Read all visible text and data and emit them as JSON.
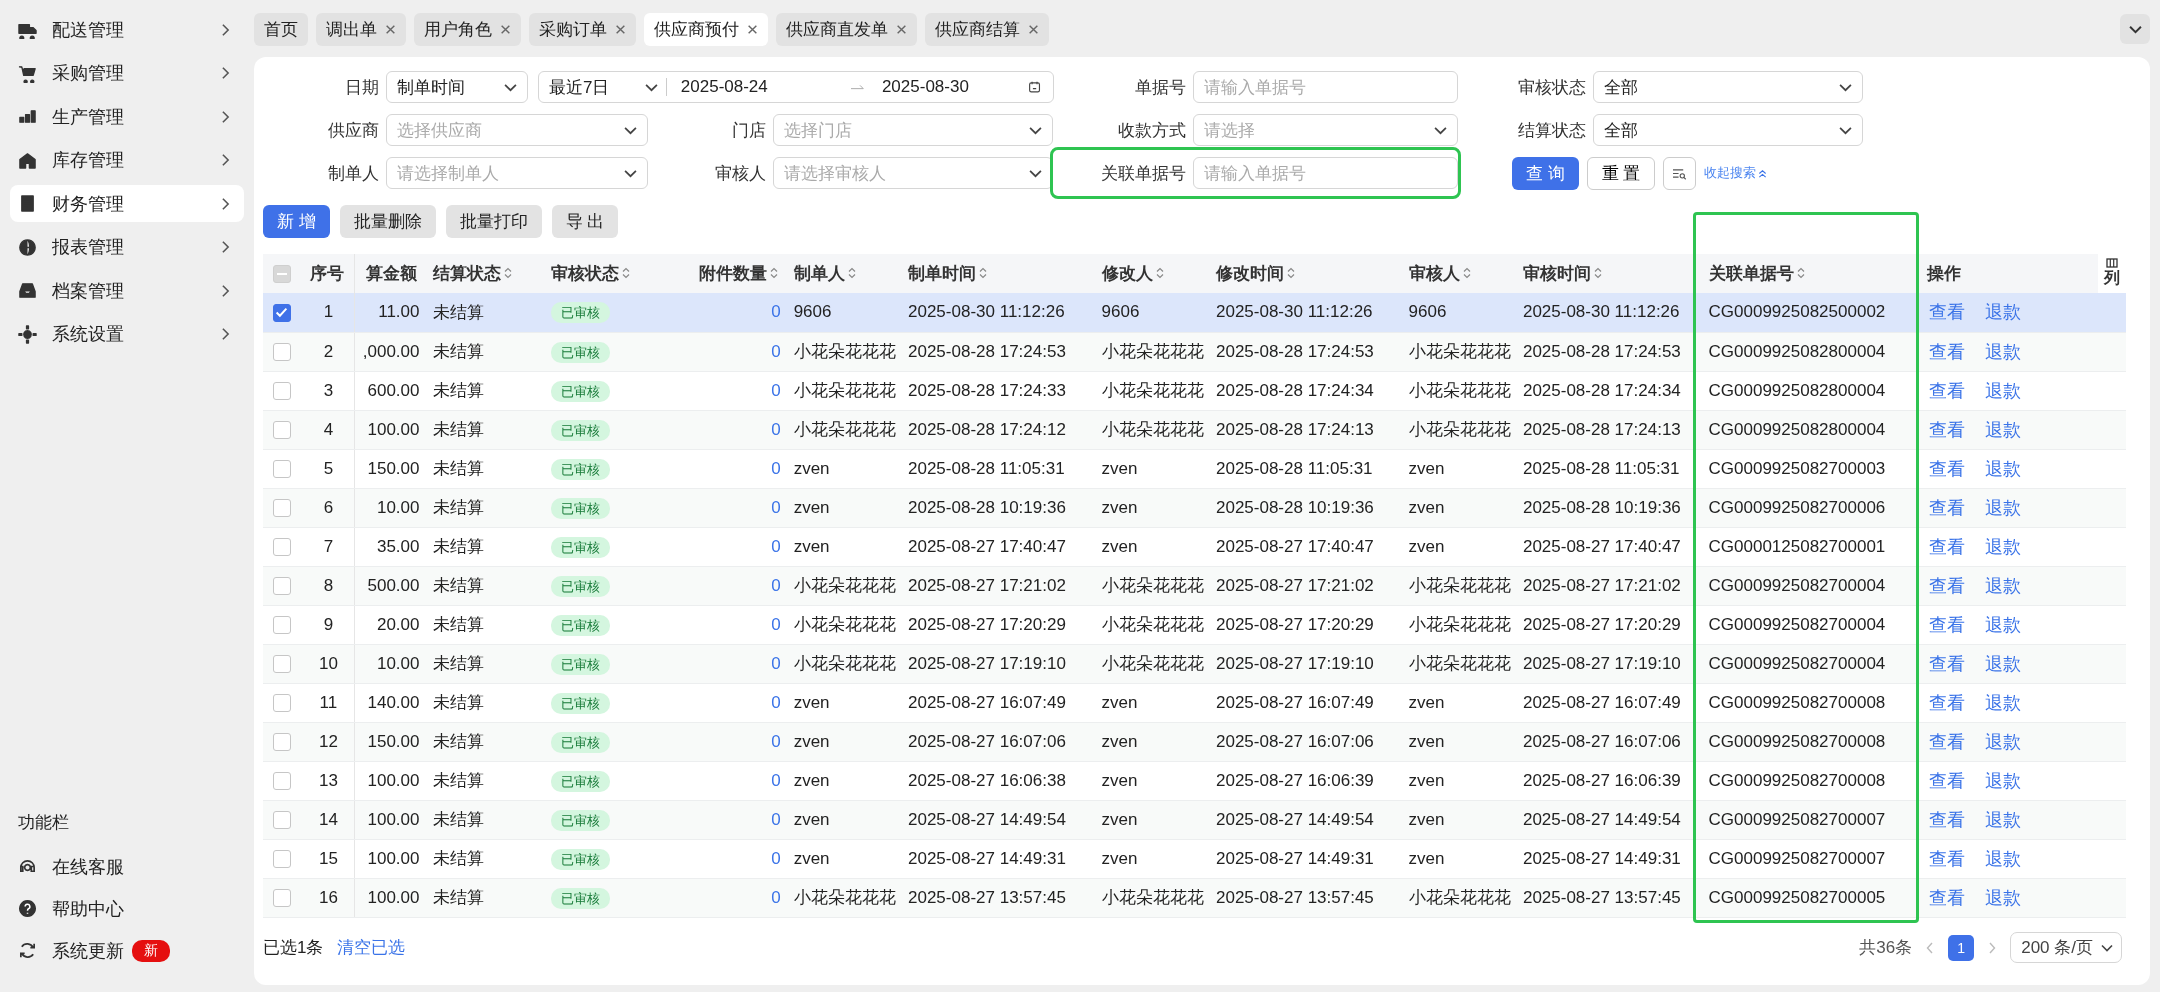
{
  "sidebar": {
    "items": [
      {
        "label": "配送管理",
        "selected": false
      },
      {
        "label": "采购管理",
        "selected": false
      },
      {
        "label": "生产管理",
        "selected": false
      },
      {
        "label": "库存管理",
        "selected": false
      },
      {
        "label": "财务管理",
        "selected": true
      },
      {
        "label": "报表管理",
        "selected": false
      },
      {
        "label": "档案管理",
        "selected": false
      },
      {
        "label": "系统设置",
        "selected": false
      }
    ],
    "footer_title": "功能栏",
    "footer_items": [
      {
        "label": "在线客服"
      },
      {
        "label": "帮助中心"
      },
      {
        "label": "系统更新",
        "badge": "新"
      }
    ]
  },
  "tabs": [
    {
      "label": "首页",
      "closable": false,
      "selected": false
    },
    {
      "label": "调出单",
      "closable": true,
      "selected": false
    },
    {
      "label": "用户角色",
      "closable": true,
      "selected": false
    },
    {
      "label": "采购订单",
      "closable": true,
      "selected": false
    },
    {
      "label": "供应商预付",
      "closable": true,
      "selected": true
    },
    {
      "label": "供应商直发单",
      "closable": true,
      "selected": false
    },
    {
      "label": "供应商结算",
      "closable": true,
      "selected": false
    }
  ],
  "filters": {
    "rows": [
      [
        {
          "kind": "date",
          "label": "日期",
          "value": "制单时间",
          "preset": "最近7日",
          "start": "2025-08-24",
          "end": "2025-08-30"
        },
        "",
        {
          "kind": "input",
          "label": "单据号",
          "placeholder": "请输入单据号"
        },
        {
          "kind": "select",
          "label": "审核状态",
          "value": "全部"
        }
      ],
      [
        {
          "kind": "select",
          "label": "供应商",
          "placeholder": "选择供应商"
        },
        {
          "kind": "select",
          "label": "门店",
          "placeholder": "选择门店"
        },
        {
          "kind": "select",
          "label": "收款方式",
          "placeholder": "请选择"
        },
        {
          "kind": "select",
          "label": "结算状态",
          "value": "全部"
        }
      ],
      [
        {
          "kind": "select",
          "label": "制单人",
          "placeholder": "请选择制单人"
        },
        {
          "kind": "select",
          "label": "审核人",
          "placeholder": "请选择审核人"
        },
        {
          "kind": "input",
          "label": "关联单据号",
          "placeholder": "请输入单据号",
          "highlighted": true
        }
      ]
    ],
    "query": "查 询",
    "reset": "重 置",
    "collapse": "收起搜索"
  },
  "actions": [
    {
      "label": "新 增",
      "primary": true
    },
    {
      "label": "批量删除",
      "primary": false
    },
    {
      "label": "批量打印",
      "primary": false
    },
    {
      "label": "导 出",
      "primary": false
    }
  ],
  "table": {
    "columns": [
      {
        "label": "序号",
        "sortable": false
      },
      {
        "label": "算金额",
        "sortable": false
      },
      {
        "label": "结算状态",
        "sortable": true
      },
      {
        "label": "审核状态",
        "sortable": true
      },
      {
        "label": "附件数量",
        "sortable": true
      },
      {
        "label": "制单人",
        "sortable": true
      },
      {
        "label": "制单时间",
        "sortable": true
      },
      {
        "label": "修改人",
        "sortable": true
      },
      {
        "label": "修改时间",
        "sortable": true
      },
      {
        "label": "审核人",
        "sortable": true
      },
      {
        "label": "审核时间",
        "sortable": true
      },
      {
        "label": "关联单据号",
        "sortable": true,
        "highlighted": true
      },
      {
        "label": "操作",
        "sortable": false
      },
      {
        "label": "列"
      }
    ],
    "select_all_checked": false,
    "select_all_partial": true,
    "rows": [
      {
        "selected": true,
        "cells": [
          "1",
          "11.00",
          "未结算",
          "已审核",
          "0",
          "9606",
          "2025-08-30 11:12:26",
          "9606",
          "2025-08-30 11:12:26",
          "9606",
          "2025-08-30 11:12:26",
          "CG0009925082500002"
        ],
        "ops": [
          "查看",
          "退款"
        ]
      },
      {
        "selected": false,
        "cells": [
          "2",
          ",000.00",
          "未结算",
          "已审核",
          "0",
          "小花朵花花花",
          "2025-08-28 17:24:53",
          "小花朵花花花",
          "2025-08-28 17:24:53",
          "小花朵花花花",
          "2025-08-28 17:24:53",
          "CG0009925082800004"
        ],
        "ops": [
          "查看",
          "退款"
        ]
      },
      {
        "selected": false,
        "cells": [
          "3",
          "600.00",
          "未结算",
          "已审核",
          "0",
          "小花朵花花花",
          "2025-08-28 17:24:33",
          "小花朵花花花",
          "2025-08-28 17:24:34",
          "小花朵花花花",
          "2025-08-28 17:24:34",
          "CG0009925082800004"
        ],
        "ops": [
          "查看",
          "退款"
        ]
      },
      {
        "selected": false,
        "cells": [
          "4",
          "100.00",
          "未结算",
          "已审核",
          "0",
          "小花朵花花花",
          "2025-08-28 17:24:12",
          "小花朵花花花",
          "2025-08-28 17:24:13",
          "小花朵花花花",
          "2025-08-28 17:24:13",
          "CG0009925082800004"
        ],
        "ops": [
          "查看",
          "退款"
        ]
      },
      {
        "selected": false,
        "cells": [
          "5",
          "150.00",
          "未结算",
          "已审核",
          "0",
          "zven",
          "2025-08-28 11:05:31",
          "zven",
          "2025-08-28 11:05:31",
          "zven",
          "2025-08-28 11:05:31",
          "CG0009925082700003"
        ],
        "ops": [
          "查看",
          "退款"
        ]
      },
      {
        "selected": false,
        "cells": [
          "6",
          "10.00",
          "未结算",
          "已审核",
          "0",
          "zven",
          "2025-08-28 10:19:36",
          "zven",
          "2025-08-28 10:19:36",
          "zven",
          "2025-08-28 10:19:36",
          "CG0009925082700006"
        ],
        "ops": [
          "查看",
          "退款"
        ]
      },
      {
        "selected": false,
        "cells": [
          "7",
          "35.00",
          "未结算",
          "已审核",
          "0",
          "zven",
          "2025-08-27 17:40:47",
          "zven",
          "2025-08-27 17:40:47",
          "zven",
          "2025-08-27 17:40:47",
          "CG0000125082700001"
        ],
        "ops": [
          "查看",
          "退款"
        ]
      },
      {
        "selected": false,
        "cells": [
          "8",
          "500.00",
          "未结算",
          "已审核",
          "0",
          "小花朵花花花",
          "2025-08-27 17:21:02",
          "小花朵花花花",
          "2025-08-27 17:21:02",
          "小花朵花花花",
          "2025-08-27 17:21:02",
          "CG0009925082700004"
        ],
        "ops": [
          "查看",
          "退款"
        ]
      },
      {
        "selected": false,
        "cells": [
          "9",
          "20.00",
          "未结算",
          "已审核",
          "0",
          "小花朵花花花",
          "2025-08-27 17:20:29",
          "小花朵花花花",
          "2025-08-27 17:20:29",
          "小花朵花花花",
          "2025-08-27 17:20:29",
          "CG0009925082700004"
        ],
        "ops": [
          "查看",
          "退款"
        ]
      },
      {
        "selected": false,
        "cells": [
          "10",
          "10.00",
          "未结算",
          "已审核",
          "0",
          "小花朵花花花",
          "2025-08-27 17:19:10",
          "小花朵花花花",
          "2025-08-27 17:19:10",
          "小花朵花花花",
          "2025-08-27 17:19:10",
          "CG0009925082700004"
        ],
        "ops": [
          "查看",
          "退款"
        ]
      },
      {
        "selected": false,
        "cells": [
          "11",
          "140.00",
          "未结算",
          "已审核",
          "0",
          "zven",
          "2025-08-27 16:07:49",
          "zven",
          "2025-08-27 16:07:49",
          "zven",
          "2025-08-27 16:07:49",
          "CG0009925082700008"
        ],
        "ops": [
          "查看",
          "退款"
        ]
      },
      {
        "selected": false,
        "cells": [
          "12",
          "150.00",
          "未结算",
          "已审核",
          "0",
          "zven",
          "2025-08-27 16:07:06",
          "zven",
          "2025-08-27 16:07:06",
          "zven",
          "2025-08-27 16:07:06",
          "CG0009925082700008"
        ],
        "ops": [
          "查看",
          "退款"
        ]
      },
      {
        "selected": false,
        "cells": [
          "13",
          "100.00",
          "未结算",
          "已审核",
          "0",
          "zven",
          "2025-08-27 16:06:38",
          "zven",
          "2025-08-27 16:06:39",
          "zven",
          "2025-08-27 16:06:39",
          "CG0009925082700008"
        ],
        "ops": [
          "查看",
          "退款"
        ]
      },
      {
        "selected": false,
        "cells": [
          "14",
          "100.00",
          "未结算",
          "已审核",
          "0",
          "zven",
          "2025-08-27 14:49:54",
          "zven",
          "2025-08-27 14:49:54",
          "zven",
          "2025-08-27 14:49:54",
          "CG0009925082700007"
        ],
        "ops": [
          "查看",
          "退款"
        ]
      },
      {
        "selected": false,
        "cells": [
          "15",
          "100.00",
          "未结算",
          "已审核",
          "0",
          "zven",
          "2025-08-27 14:49:31",
          "zven",
          "2025-08-27 14:49:31",
          "zven",
          "2025-08-27 14:49:31",
          "CG0009925082700007"
        ],
        "ops": [
          "查看",
          "退款"
        ]
      },
      {
        "selected": false,
        "cells": [
          "16",
          "100.00",
          "未结算",
          "已审核",
          "0",
          "小花朵花花花",
          "2025-08-27 13:57:45",
          "小花朵花花花",
          "2025-08-27 13:57:45",
          "小花朵花花花",
          "2025-08-27 13:57:45",
          "CG0009925082700005"
        ],
        "ops": [
          "查看",
          "退款"
        ]
      }
    ]
  },
  "footer": {
    "selected_count": "已选1条",
    "clear": "清空已选",
    "total": "共36条",
    "pages": [
      {
        "label": "1",
        "selected": true
      }
    ],
    "page_size": "200 条/页"
  }
}
